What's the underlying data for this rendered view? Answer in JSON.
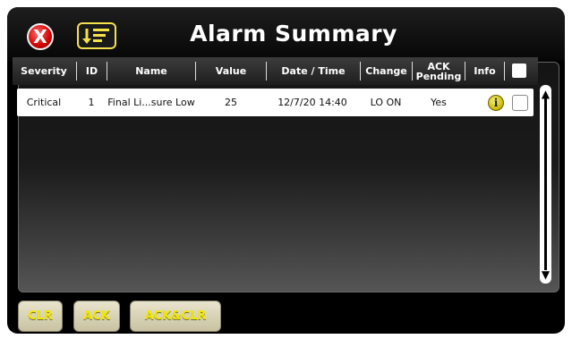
{
  "header": {
    "title": "Alarm Summary",
    "close_glyph": "X"
  },
  "table": {
    "columns": [
      "Severity",
      "ID",
      "Name",
      "Value",
      "Date / Time",
      "Change",
      "ACK Pending",
      "Info"
    ],
    "ack_pending_line1": "ACK",
    "ack_pending_line2": "Pending",
    "rows": [
      {
        "severity": "Critical",
        "id": "1",
        "name": "Final Li...sure Low",
        "value": "25",
        "datetime": "12/7/20 14:40",
        "change": "LO ON",
        "ack_pending": "Yes",
        "info_glyph": "i"
      }
    ]
  },
  "footer": {
    "clr_label": "CLR",
    "ack_label": "ACK",
    "ackclr_label": "ACK&CLR"
  },
  "colors": {
    "accent_yellow": "#f2e900",
    "close_red": "#d10000"
  },
  "icons": {
    "close": "close-icon",
    "sort": "sort-icon",
    "info": "info-icon",
    "scroll_up": "scroll-up-icon",
    "scroll_down": "scroll-down-icon"
  }
}
